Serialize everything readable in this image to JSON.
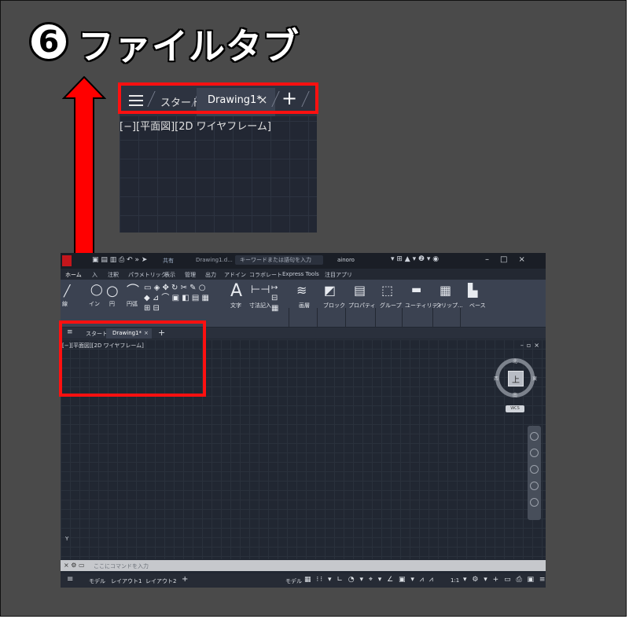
{
  "header": {
    "number": "6",
    "title": "ファイルタブ"
  },
  "zoom": {
    "menu_icon": "hamburger-menu-icon",
    "start_tab": "スタート",
    "drawing_tab": "Drawing1*",
    "close_glyph": "×",
    "new_tab_glyph": "+",
    "viewport_label": "[−][平面図][2D ワイヤフレーム]"
  },
  "acad": {
    "titlebar": {
      "share": "共有",
      "file_name": "Drawing1.d...",
      "search_placeholder": "キーワードまたは語句を入力",
      "user": "ainoro"
    },
    "ribbon_tabs": [
      "ホーム",
      "入",
      "注釈",
      "パラメトリック",
      "表示",
      "管理",
      "出力",
      "アドイン",
      "コラボレート",
      "Express Tools",
      "注目アプリ"
    ],
    "ribbon_items": {
      "line": "線",
      "polyline": "イン",
      "circle": "円",
      "arc": "円弧",
      "text": "文字",
      "dimension": "寸法記入",
      "layer": "画層",
      "block": "ブロック",
      "properties": "プロパティ",
      "group": "グループ",
      "utility": "ユーティリティ",
      "clipboard": "クリップ...",
      "base": "ベース"
    },
    "panel_labels": {
      "annotation": "注釈",
      "view": "表示"
    },
    "file_tabs": {
      "start": "スタート",
      "drawing": "Drawing1*",
      "close": "×",
      "new": "+"
    },
    "viewport_label": "[−][平面図][2D ワイヤフレーム]",
    "viewcube": {
      "top": "上",
      "north": "北",
      "south": "南",
      "east": "東",
      "west": "西",
      "wcs": "WCS"
    },
    "ucs_y": "Y",
    "command_placeholder": "ここにコマンドを入力",
    "status": {
      "model": "モデル",
      "layout1": "レイアウト1",
      "layout2": "レイアウト2",
      "plus": "+",
      "model_btn": "モデル",
      "scale": "1:1"
    }
  },
  "colors": {
    "highlight": "#ff1010",
    "arrow": "#ff0000",
    "background": "#4a4a4a"
  }
}
